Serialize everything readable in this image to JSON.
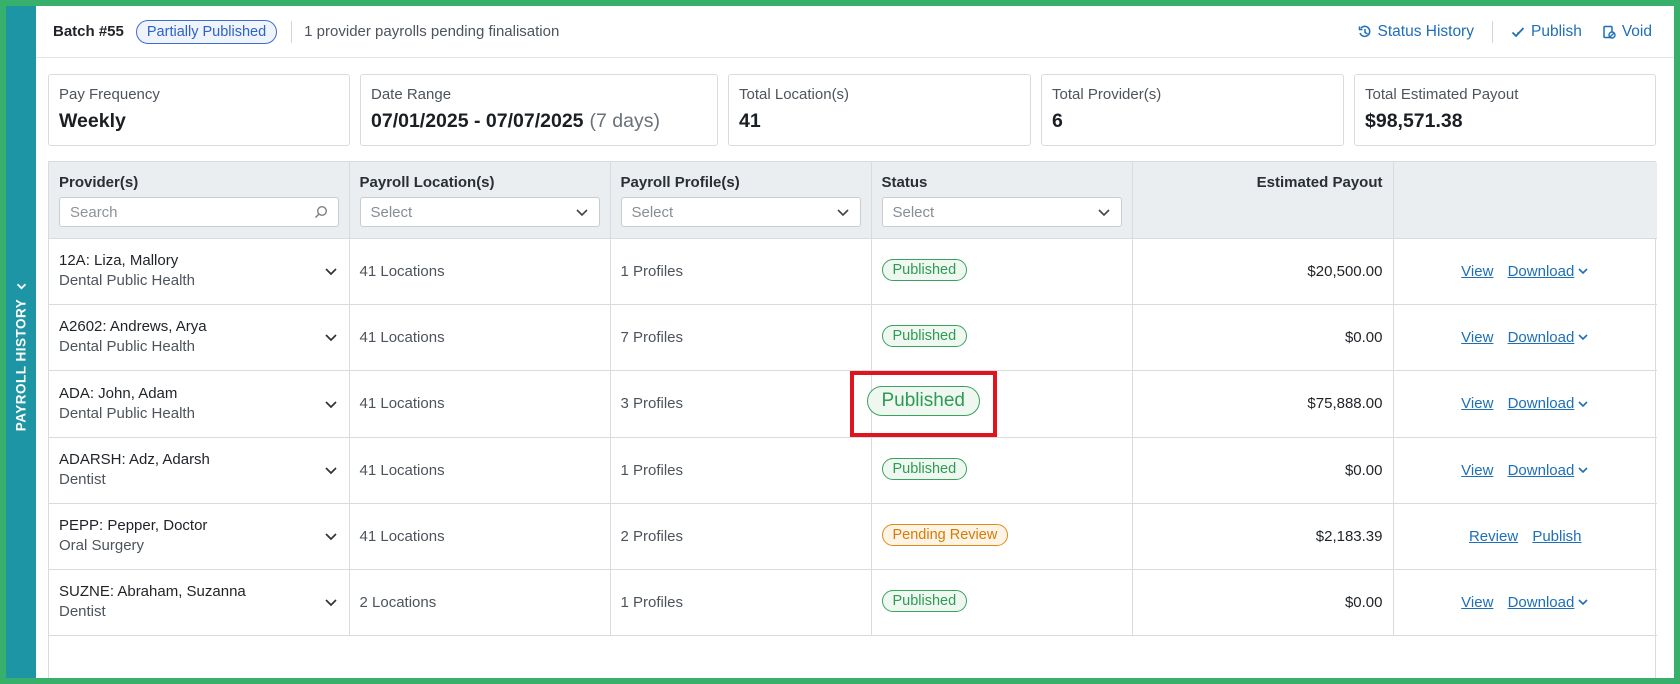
{
  "side_tab": {
    "label": "PAYROLL HISTORY",
    "color": "#1e95a4"
  },
  "header": {
    "title": "Batch #55",
    "badge": "Partially Published",
    "note": "1 provider payrolls pending finalisation",
    "actions": {
      "status_history": "Status History",
      "publish": "Publish",
      "void": "Void"
    }
  },
  "summary": {
    "pay_frequency": {
      "label": "Pay Frequency",
      "value": "Weekly"
    },
    "date_range": {
      "label": "Date Range",
      "value": "07/01/2025 - 07/07/2025",
      "extra": "(7 days)"
    },
    "total_locations": {
      "label": "Total Location(s)",
      "value": "41"
    },
    "total_providers": {
      "label": "Total Provider(s)",
      "value": "6"
    },
    "total_payout": {
      "label": "Total Estimated Payout",
      "value": "$98,571.38"
    }
  },
  "table": {
    "headers": {
      "provider": "Provider(s)",
      "location": "Payroll Location(s)",
      "profile": "Payroll Profile(s)",
      "status": "Status",
      "payout": "Estimated Payout"
    },
    "filters": {
      "search_placeholder": "Search",
      "select_placeholder": "Select"
    },
    "rows": [
      {
        "name": "12A: Liza, Mallory",
        "specialty": "Dental Public Health",
        "locations": "41 Locations",
        "profiles": "1 Profiles",
        "status": "Published",
        "payout": "$20,500.00",
        "action1": "View",
        "action2": "Download"
      },
      {
        "name": "A2602: Andrews, Arya",
        "specialty": "Dental Public Health",
        "locations": "41 Locations",
        "profiles": "7 Profiles",
        "status": "Published",
        "payout": "$0.00",
        "action1": "View",
        "action2": "Download"
      },
      {
        "name": "ADA: John, Adam",
        "specialty": "Dental Public Health",
        "locations": "41 Locations",
        "profiles": "3 Profiles",
        "status": "Published",
        "payout": "$75,888.00",
        "action1": "View",
        "action2": "Download"
      },
      {
        "name": "ADARSH: Adz, Adarsh",
        "specialty": "Dentist",
        "locations": "41 Locations",
        "profiles": "1 Profiles",
        "status": "Published",
        "payout": "$0.00",
        "action1": "View",
        "action2": "Download"
      },
      {
        "name": "PEPP: Pepper, Doctor",
        "specialty": "Oral Surgery",
        "locations": "41 Locations",
        "profiles": "2 Profiles",
        "status": "Pending Review",
        "payout": "$2,183.39",
        "action1": "Review",
        "action2": "Publish"
      },
      {
        "name": "SUZNE: Abraham, Suzanna",
        "specialty": "Dentist",
        "locations": "2 Locations",
        "profiles": "1 Profiles",
        "status": "Published",
        "payout": "$0.00",
        "action1": "View",
        "action2": "Download"
      }
    ]
  },
  "colors": {
    "frame": "#36b06a",
    "link": "#1d6fb8",
    "published": "#2f9a54",
    "pending": "#d67b08",
    "highlight": "#e0141e"
  },
  "icons": [
    "chevron-down-icon",
    "search-icon",
    "history-icon",
    "check-icon",
    "void-icon"
  ]
}
